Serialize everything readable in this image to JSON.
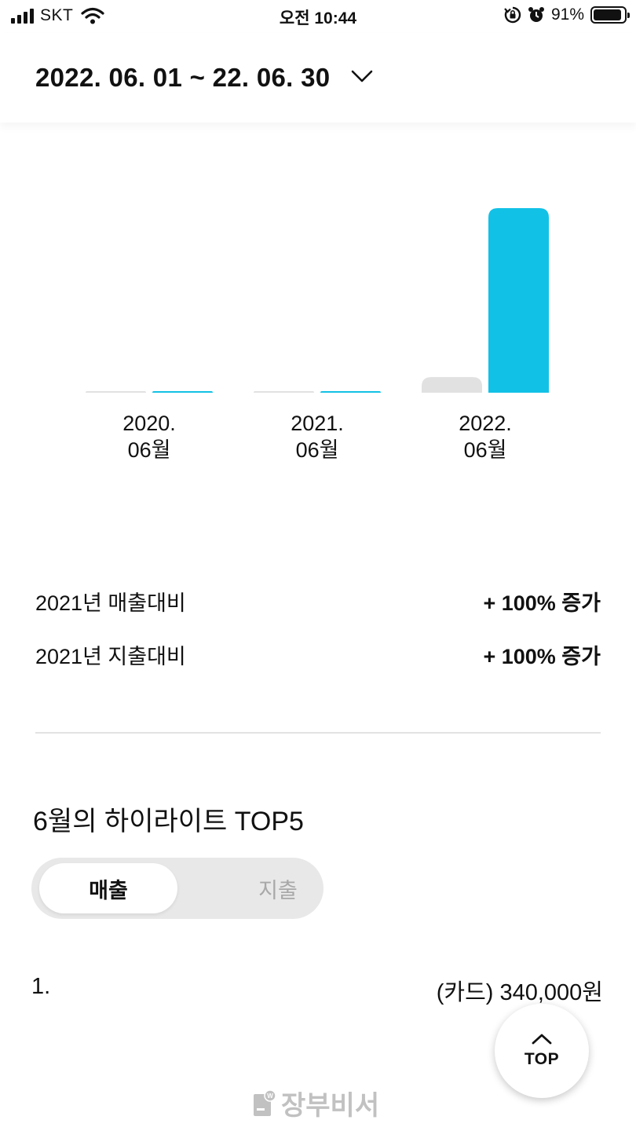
{
  "status_bar": {
    "carrier": "SKT",
    "time": "오전 10:44",
    "battery_text": "91%",
    "battery_level": 0.91
  },
  "header": {
    "date_range": "2022. 06. 01 ~ 22. 06. 30"
  },
  "chart_data": {
    "type": "bar",
    "categories": [
      "2020.\n06월",
      "2021.\n06월",
      "2022.\n06월"
    ],
    "series": [
      {
        "values": [
          0.1,
          0.1,
          2.0
        ],
        "color": "#e1e1e1"
      },
      {
        "values": [
          0.1,
          0.1,
          23.7
        ],
        "color": "#12c1e6"
      }
    ],
    "ylim": [
      0,
      24
    ],
    "grid": false,
    "legend": "none"
  },
  "comparisons": [
    {
      "label": "2021년 매출대비",
      "value": "+ 100% 증가"
    },
    {
      "label": "2021년 지출대비",
      "value": "+ 100% 증가"
    }
  ],
  "highlight": {
    "title": "6월의 하이라이트 TOP5",
    "tabs": {
      "active": "매출",
      "inactive": "지출"
    },
    "items": [
      {
        "rank": "1.",
        "value": "(카드) 340,000원"
      }
    ]
  },
  "top_button": {
    "label": "TOP"
  },
  "footer": {
    "logo_text": "장부비서"
  }
}
